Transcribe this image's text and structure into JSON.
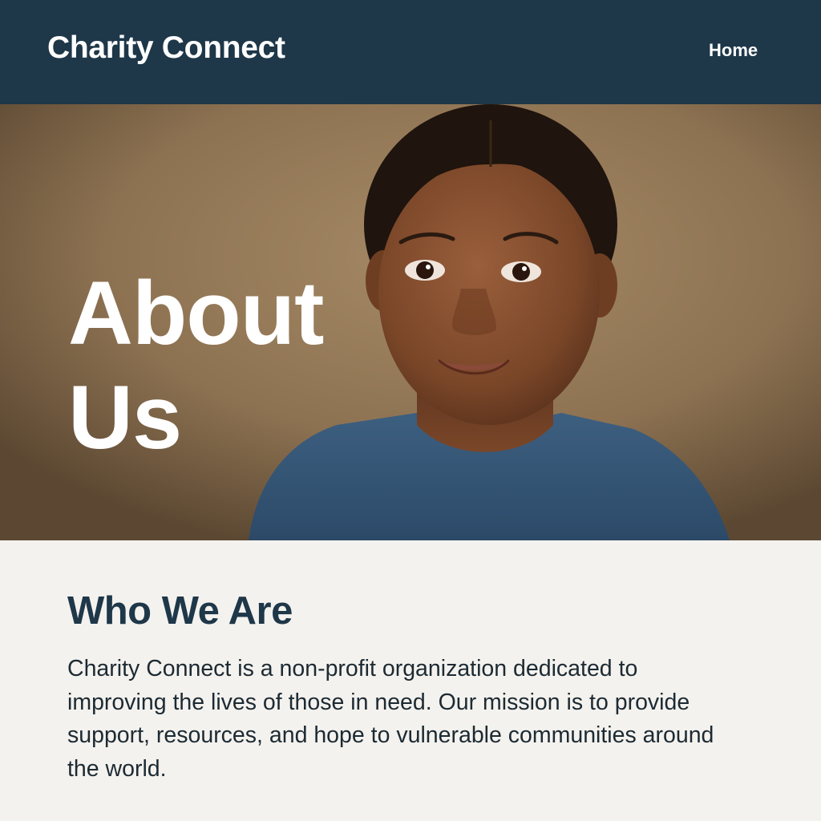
{
  "header": {
    "brand": "Charity Connect",
    "nav": {
      "home_label": "Home"
    }
  },
  "hero": {
    "title_line1": "About",
    "title_line2": "Us",
    "image_subject": "smiling-child-portrait"
  },
  "about": {
    "heading": "Who We Are",
    "body": "Charity Connect is a non-profit organization dedicated to improving the lives of those in need. Our mission is to provide support, resources, and hope to vulnerable communities around the world."
  },
  "colors": {
    "navbar": "#1e3749",
    "heading": "#1e3749",
    "page_background": "#f4f2ee",
    "hero_text": "#ffffff"
  }
}
